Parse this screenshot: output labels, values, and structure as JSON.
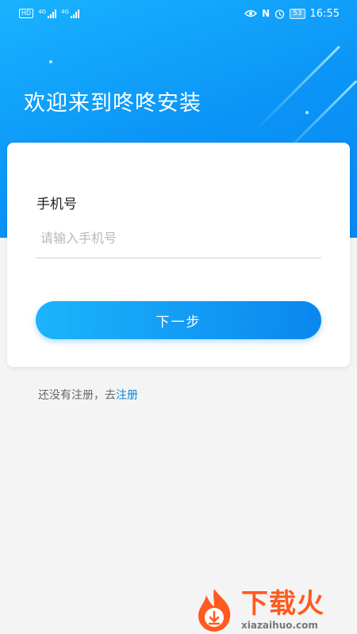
{
  "status_bar": {
    "hd_badge": "HD",
    "network_1": "4G",
    "network_2": "4G",
    "nfc_label": "N",
    "battery_level": "53",
    "time": "16:55"
  },
  "header": {
    "welcome_text": "欢迎来到咚咚安装"
  },
  "login_form": {
    "phone_label": "手机号",
    "phone_placeholder": "请输入手机号",
    "phone_value": "",
    "next_button_label": "下一步"
  },
  "register_prompt": {
    "text": "还没有注册，去",
    "link_label": "注册"
  },
  "watermark": {
    "title": "下载火",
    "subtitle": "xiazaihuo.com"
  },
  "colors": {
    "accent_blue": "#0a86f0",
    "hero_top": "#19b3ff",
    "link_blue": "#0a86d8",
    "watermark_orange": "#ff5a1f"
  }
}
